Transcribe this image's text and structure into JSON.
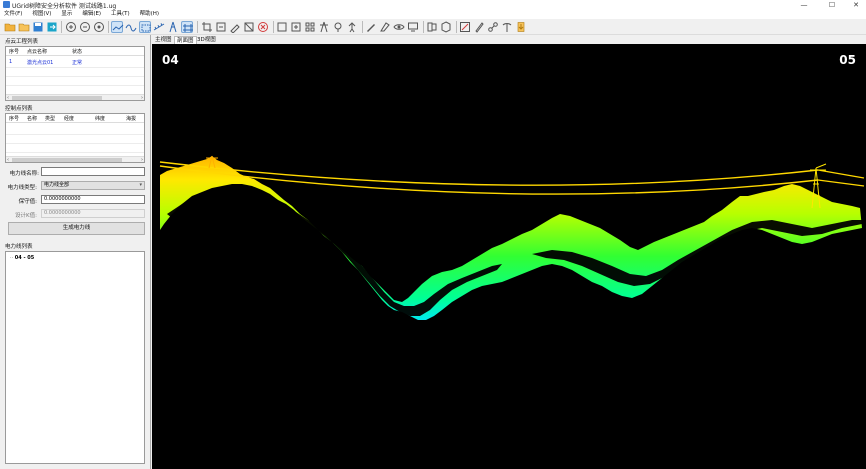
{
  "window": {
    "title": "UGrid树障安全分析软件 测试线路1.ug",
    "minimize": "—",
    "maximize": "☐",
    "close": "✕"
  },
  "menu": [
    "文件(F)",
    "视图(V)",
    "显示",
    "编辑(E)",
    "工具(T)",
    "帮助(H)"
  ],
  "toolbar": {
    "icons": [
      "folder-open-icon",
      "folder-icon",
      "save-icon",
      "export-icon",
      "zoom-in-icon",
      "zoom-out-icon",
      "zoom-fit-icon",
      "profile-view-icon",
      "pan-view-icon",
      "select-box-icon",
      "measure-icon",
      "tower-mode-icon",
      "transform-icon",
      "crop-icon",
      "wrench-icon",
      "erase-icon",
      "close-circle-icon",
      "add-box-icon",
      "add-square-icon",
      "classify-icon",
      "tower-icon",
      "tree-icon",
      "person-icon",
      "brush-icon",
      "paint-icon",
      "eye-icon",
      "screen-icon",
      "layer-icon",
      "cube-icon",
      "edit-icon",
      "pen-icon",
      "link-icon",
      "pole-icon",
      "report-icon"
    ]
  },
  "project_panel": {
    "title": "点云工程列表",
    "columns": [
      "序号",
      "点云名称",
      "状态"
    ],
    "rows": [
      [
        "1",
        "激光点云01",
        "正常"
      ]
    ]
  },
  "control_panel": {
    "title": "控制点列表",
    "columns": [
      "序号",
      "名称",
      "类型",
      "经度",
      "纬度",
      "海拔"
    ]
  },
  "powerline_form": {
    "name_label": "电力线名称:",
    "name_value": "",
    "type_label": "电力线类型:",
    "type_value": "电力线全部",
    "safe_label": "保守值:",
    "safe_value": "0.0000000000",
    "design_label": "设计K值:",
    "design_value": "0.0000000000",
    "generate_button": "生成电力线"
  },
  "powerline_list": {
    "title": "电力线列表",
    "items": [
      "04 - 05"
    ]
  },
  "view_tabs": [
    "主视图",
    "剖面图",
    "3D视图"
  ],
  "active_tab": 1,
  "viewport": {
    "left_tower_label": "04",
    "right_tower_label": "05",
    "background": "#000000",
    "gradient_colors": [
      "#ffb000",
      "#ffe800",
      "#b8ff00",
      "#32ff32",
      "#00ff96",
      "#00e5ff"
    ],
    "wire_color": "#ffd800"
  }
}
